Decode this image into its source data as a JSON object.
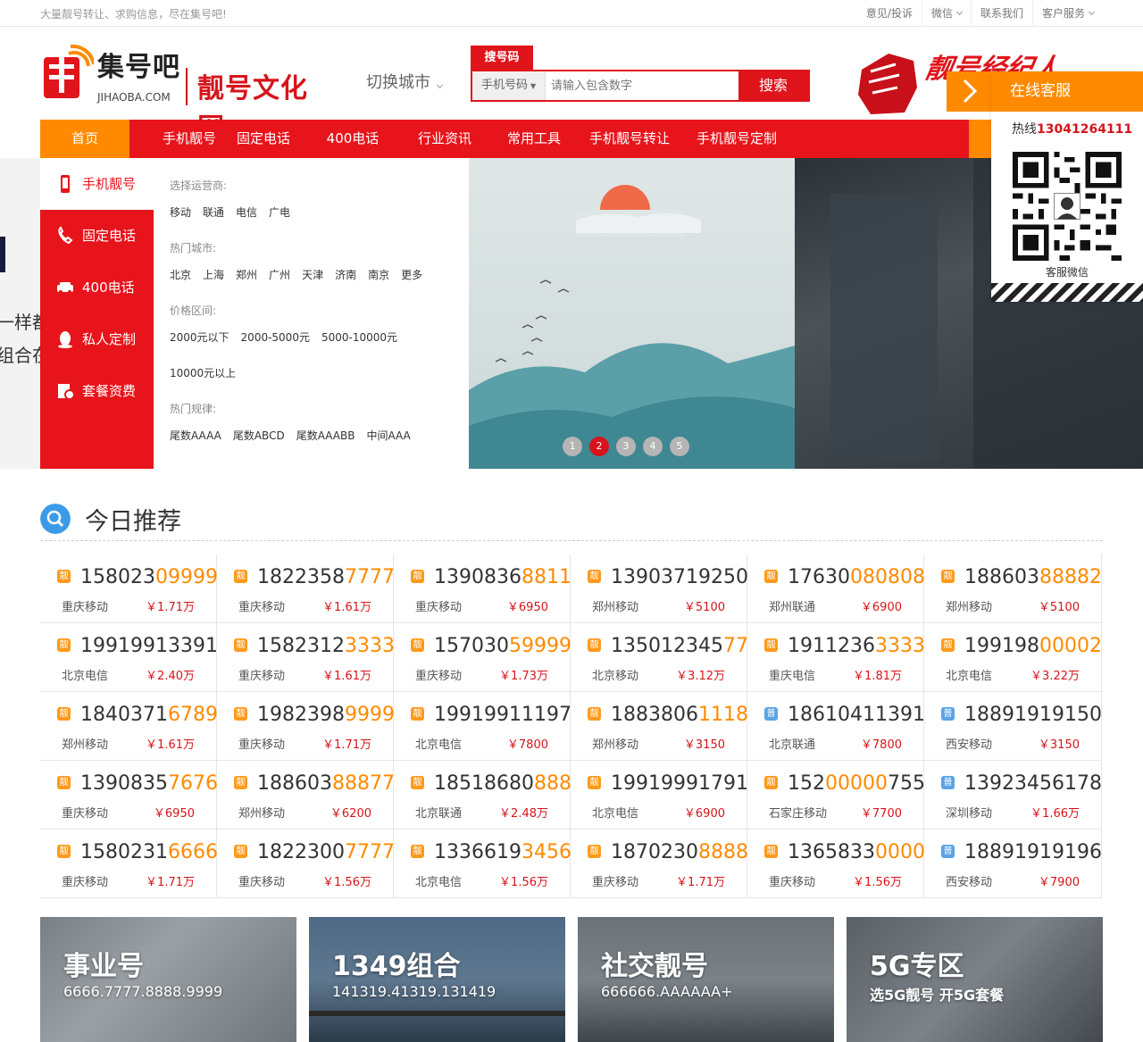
{
  "topbar": {
    "slogan": "大量靓号转让、求购信息，尽在集号吧!",
    "links": [
      "意见/投诉",
      "微信",
      "联系我们",
      "客户服务"
    ]
  },
  "logo": {
    "name": "集号吧",
    "en": "JIHAOBA.COM",
    "title": "靓号文化网"
  },
  "city_switch": "切换城市",
  "search": {
    "tab": "搜号码",
    "type": "手机号码",
    "placeholder": "请输入包含数字",
    "button": "搜索"
  },
  "ad_text": "靓号经纪人",
  "nav": [
    "首页",
    "手机靓号",
    "固定电话",
    "400电话",
    "行业资讯",
    "常用工具",
    "手机靓号转让",
    "手机靓号定制"
  ],
  "sidemenu": [
    "手机靓号",
    "固定电话",
    "400电话",
    "私人定制",
    "套餐资费"
  ],
  "panel": {
    "operator_label": "选择运营商:",
    "operators": [
      "移动",
      "联通",
      "电信",
      "广电"
    ],
    "city_label": "热门城市:",
    "cities": [
      "北京",
      "上海",
      "郑州",
      "广州",
      "天津",
      "济南",
      "南京",
      "更多"
    ],
    "price_label": "价格区间:",
    "prices": [
      "2000元以下",
      "2000-5000元",
      "5000-10000元",
      "10000元以上"
    ],
    "rule_label": "热门规律:",
    "rules": [
      "尾数AAAA",
      "尾数ABCD",
      "尾数AAABB",
      "中间AAA"
    ]
  },
  "hero_peek": [
    "一样都",
    "组合在"
  ],
  "slider_dots": [
    "1",
    "2",
    "3",
    "4",
    "5"
  ],
  "active_dot": 2,
  "service": {
    "title": "在线客服",
    "hotline_label": "热线",
    "hotline": "13041264111",
    "qr_label": "客服微信"
  },
  "recommend": {
    "title": "今日推荐",
    "items": [
      {
        "badge": "靓",
        "plain": "158023",
        "hl": "09999",
        "loc": "重庆移动",
        "price": "￥1.71万"
      },
      {
        "badge": "靓",
        "plain": "1822358",
        "hl": "7777",
        "loc": "重庆移动",
        "price": "￥1.61万"
      },
      {
        "badge": "靓",
        "plain": "1390836",
        "hl": "8811",
        "loc": "重庆移动",
        "price": "￥6950"
      },
      {
        "badge": "靓",
        "plain": "13903719250",
        "hl": "",
        "loc": "郑州移动",
        "price": "￥5100"
      },
      {
        "badge": "靓",
        "plain": "17630",
        "hl": "080808",
        "loc": "郑州联通",
        "price": "￥6900"
      },
      {
        "badge": "靓",
        "plain": "188603",
        "hl": "88882",
        "loc": "郑州移动",
        "price": "￥5100"
      },
      {
        "badge": "靓",
        "plain": "19919913391",
        "hl": "",
        "loc": "北京电信",
        "price": "￥2.40万"
      },
      {
        "badge": "靓",
        "plain": "1582312",
        "hl": "3333",
        "loc": "重庆移动",
        "price": "￥1.61万"
      },
      {
        "badge": "靓",
        "plain": "157030",
        "hl": "59999",
        "loc": "重庆移动",
        "price": "￥1.73万"
      },
      {
        "badge": "靓",
        "plain": "135012345",
        "hl": "77",
        "loc": "北京移动",
        "price": "￥3.12万"
      },
      {
        "badge": "靓",
        "plain": "1911236",
        "hl": "3333",
        "loc": "重庆电信",
        "price": "￥1.81万"
      },
      {
        "badge": "靓",
        "plain": "199198",
        "hl": "00002",
        "loc": "北京电信",
        "price": "￥3.22万"
      },
      {
        "badge": "靓",
        "plain": "1840371",
        "hl": "6789",
        "loc": "郑州移动",
        "price": "￥1.61万"
      },
      {
        "badge": "靓",
        "plain": "1982398",
        "hl": "9999",
        "loc": "重庆移动",
        "price": "￥1.71万"
      },
      {
        "badge": "靓",
        "plain": "19919911197",
        "hl": "",
        "loc": "北京电信",
        "price": "￥7800"
      },
      {
        "badge": "靓",
        "plain": "1883806",
        "hl": "1118",
        "loc": "郑州移动",
        "price": "￥3150"
      },
      {
        "badge": "普",
        "plain": "18610411391",
        "hl": "",
        "loc": "北京联通",
        "price": "￥7800"
      },
      {
        "badge": "普",
        "plain": "18891919150",
        "hl": "",
        "loc": "西安移动",
        "price": "￥3150"
      },
      {
        "badge": "靓",
        "plain": "1390835",
        "hl": "7676",
        "loc": "重庆移动",
        "price": "￥6950"
      },
      {
        "badge": "靓",
        "plain": "188603",
        "hl": "88877",
        "loc": "郑州移动",
        "price": "￥6200"
      },
      {
        "badge": "靓",
        "plain": "18518680",
        "hl": "888",
        "loc": "北京联通",
        "price": "￥2.48万"
      },
      {
        "badge": "靓",
        "plain": "19919991791",
        "hl": "",
        "loc": "北京电信",
        "price": "￥6900"
      },
      {
        "badge": "靓",
        "plain": "152",
        "hl": "00000",
        "plain2": "755",
        "loc": "石家庄移动",
        "price": "￥7700"
      },
      {
        "badge": "普",
        "plain": "13923456178",
        "hl": "",
        "loc": "深圳移动",
        "price": "￥1.66万"
      },
      {
        "badge": "靓",
        "plain": "1580231",
        "hl": "6666",
        "loc": "重庆移动",
        "price": "￥1.71万"
      },
      {
        "badge": "靓",
        "plain": "1822300",
        "hl": "7777",
        "loc": "重庆移动",
        "price": "￥1.56万"
      },
      {
        "badge": "靓",
        "plain": "1336619",
        "hl": "3456",
        "loc": "北京电信",
        "price": "￥1.56万"
      },
      {
        "badge": "靓",
        "plain": "1870230",
        "hl": "8888",
        "loc": "重庆移动",
        "price": "￥1.71万"
      },
      {
        "badge": "靓",
        "plain": "1365833",
        "hl": "0000",
        "loc": "重庆移动",
        "price": "￥1.56万"
      },
      {
        "badge": "普",
        "plain": "18891919196",
        "hl": "",
        "loc": "西安移动",
        "price": "￥7900"
      }
    ]
  },
  "cards": [
    {
      "title": "事业号",
      "sub": "6666.7777.8888.9999"
    },
    {
      "title": "1349组合",
      "sub": "141319.41319.131419"
    },
    {
      "title": "社交靓号",
      "sub": "666666.AAAAAA+"
    },
    {
      "title": "5G专区",
      "sub": "选5G靓号  开5G套餐"
    }
  ]
}
